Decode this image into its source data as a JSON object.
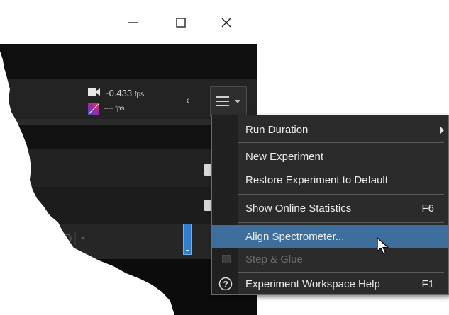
{
  "fps": {
    "camera_rate_value": "~0.433",
    "camera_rate_unit": "fps",
    "secondary_rate": "---- fps"
  },
  "toolbar": {
    "collapse_glyph": "‹",
    "menu_icon": "hamburger-icon"
  },
  "window_controls": [
    "minimize",
    "maximize",
    "close"
  ],
  "menu": {
    "items": [
      {
        "label": "Run Duration",
        "has_submenu": true
      },
      {
        "label": "New Experiment"
      },
      {
        "label": "Restore Experiment to Default"
      },
      {
        "label": "Show Online Statistics",
        "shortcut": "F6"
      },
      {
        "label": "Align Spectrometer...",
        "highlighted": true
      },
      {
        "label": "Step & Glue",
        "enabled": false
      },
      {
        "label": "Experiment Workspace Help",
        "shortcut": "F1",
        "icon": "help-icon"
      }
    ]
  },
  "colors": {
    "menu_bg": "#2b2b2b",
    "highlight": "#3d6e9c",
    "accent_scrollbar": "#2f7fd0",
    "disabled_text": "#6b6b6b"
  }
}
